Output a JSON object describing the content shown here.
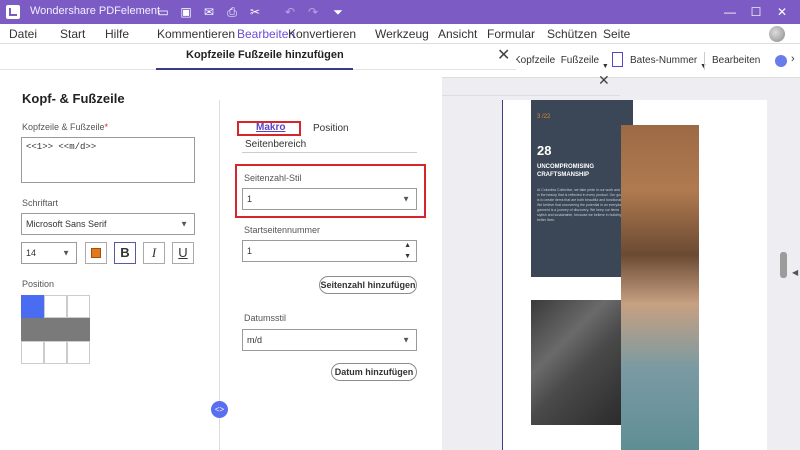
{
  "app": {
    "title": "Wondershare PDFelement"
  },
  "menu": {
    "items": [
      {
        "label": "Datei"
      },
      {
        "label": "Start"
      },
      {
        "label": "Hilfe"
      },
      {
        "label": "Kommentieren"
      },
      {
        "label": "Bearbeiten"
      },
      {
        "label": "Konvertieren"
      },
      {
        "label": "Werkzeug"
      },
      {
        "label": "Ansicht"
      },
      {
        "label": "Formular"
      },
      {
        "label": "Schützen"
      },
      {
        "label": "Seite"
      }
    ],
    "active": "Bearbeiten"
  },
  "toolbar": {
    "header_footer_label": "Kopfzeile",
    "footer_label": "Fußzeile",
    "bates_label": "Bates-Nummer",
    "edit_label": "Bearbeiten"
  },
  "dialog": {
    "title": "Kopfzeile Fußzeile hinzufügen",
    "heading": "Kopf- & Fußzeile",
    "text_label": "Kopfzeile & Fußzeile",
    "required_mark": "*",
    "text_value": "<<1>> <<m/d>>",
    "font_label": "Schriftart",
    "font_value": "Microsoft Sans Serif",
    "size_value": "14",
    "bold_label": "B",
    "italic_label": "I",
    "underline_label": "U",
    "position_label": "Position",
    "tabs": [
      {
        "label": "Makro"
      },
      {
        "label": "Position"
      },
      {
        "label": "Seitenbereich"
      }
    ],
    "page_number_style_label": "Seitenzahl-Stil",
    "page_number_style_value": "1",
    "start_page_label": "Startseitennummer",
    "start_page_value": "1",
    "add_page_number_button": "Seitenzahl hinzufügen",
    "date_style_label": "Datumsstil",
    "date_style_value": "m/d",
    "add_date_button": "Datum hinzufügen"
  },
  "document": {
    "page_label": "3 /22",
    "number": "28",
    "headline_line1": "UNCOMPROMISING",
    "headline_line2": "CRAFTSMANSHIP",
    "body_text": "At Columbia Collective, we take pride in our work and in the beauty that is reflected in every product. Our goal is to create items that are both beautiful and functional. We believe that uncovering the potential in an everyday garment is a journey of discovery. We keep our items stylish and sustainable, because we believe in building better lives."
  },
  "colors": {
    "titlebar": "#7c5cc4",
    "accent": "#6a4dd6",
    "highlight_red": "#d6262b",
    "font_color_swatch": "#e07a1d",
    "position_selected": "#4a6cf0",
    "position_filled": "#7a7a7a",
    "doc_panel_dark": "#3b4656"
  }
}
